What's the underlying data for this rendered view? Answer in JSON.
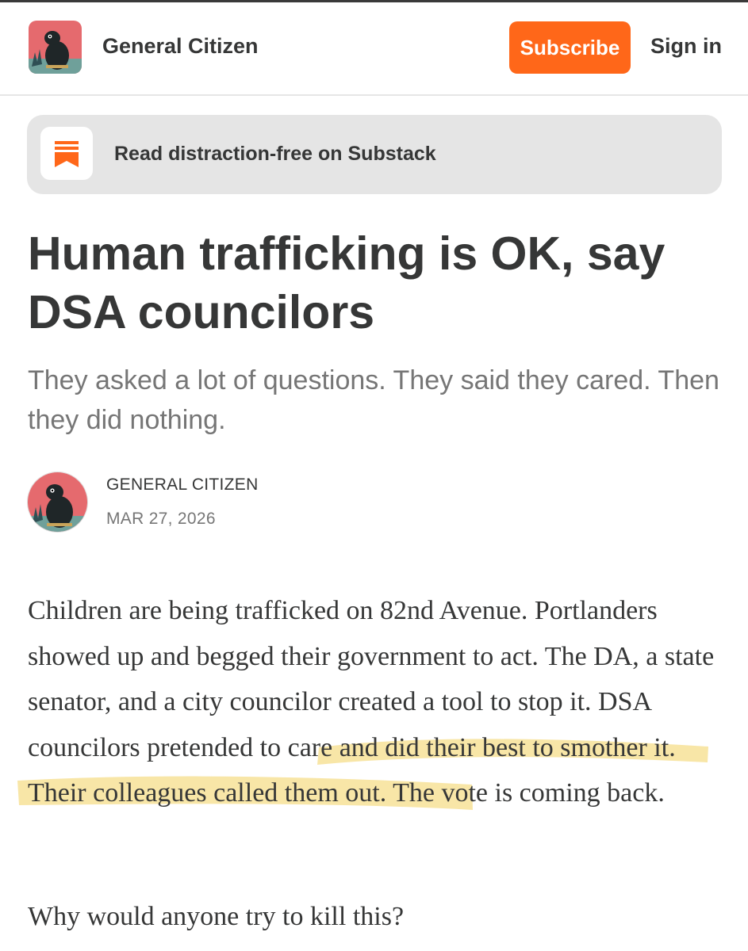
{
  "header": {
    "publication_name": "General Citizen",
    "subscribe_label": "Subscribe",
    "signin_label": "Sign in"
  },
  "banner": {
    "text": "Read distraction-free on Substack"
  },
  "article": {
    "title": "Human trafficking is OK, say DSA councilors",
    "subtitle": "They asked a lot of questions. They said they cared. Then they did nothing.",
    "author": "GENERAL CITIZEN",
    "date": "MAR 27, 2026",
    "paragraph1_before": "Children are being trafficked on 82nd Avenue. Portlanders showed up and begged their government to act. The DA, a state senator, and a city councilor created a tool to stop it. ",
    "paragraph1_highlight": "DSA councilors pretended to care and did their best to smother it",
    "paragraph1_after": ". Their colleagues called them out. The vote is coming back.",
    "paragraph2": "Why would anyone try to kill this?"
  },
  "colors": {
    "accent": "#ff6719",
    "text": "#363737",
    "muted": "#767676",
    "highlight": "#f6dd8a"
  },
  "icons": [
    "publication-logo-icon",
    "substack-bookmark-icon",
    "author-avatar-icon"
  ]
}
